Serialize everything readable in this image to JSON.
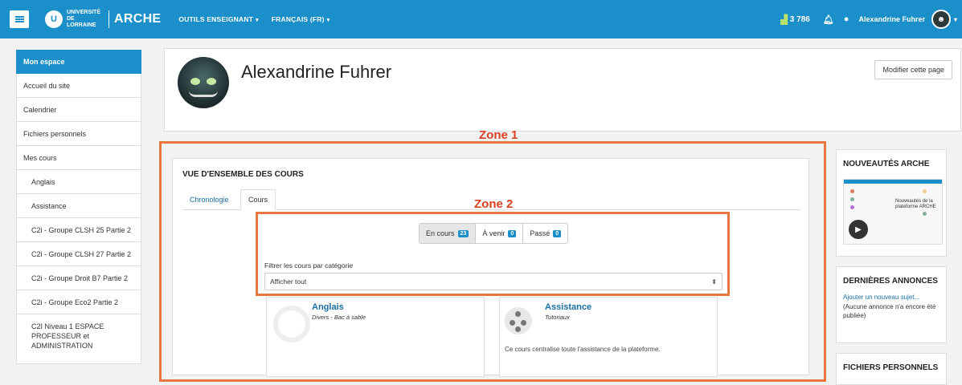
{
  "topbar": {
    "logo_mark": "U",
    "logo_university": "UNIVERSITÉ DE LORRAINE",
    "logo_app": "ARCHE",
    "nav": [
      {
        "label": "OUTILS ENSEIGNANT"
      },
      {
        "label": "FRANÇAIS (FR)"
      }
    ],
    "count": "3 786",
    "username": "Alexandrine Fuhrer"
  },
  "sidebar": {
    "items": [
      {
        "label": "Mon espace"
      },
      {
        "label": "Accueil du site"
      },
      {
        "label": "Calendrier"
      },
      {
        "label": "Fichiers personnels"
      },
      {
        "label": "Mes cours"
      },
      {
        "label": "Anglais"
      },
      {
        "label": "Assistance"
      },
      {
        "label": "C2i - Groupe CLSH 25 Partie 2"
      },
      {
        "label": "C2i - Groupe CLSH 27 Partie 2"
      },
      {
        "label": "C2i - Groupe Droit B7 Partie 2"
      },
      {
        "label": "C2i - Groupe Eco2 Partie 2"
      },
      {
        "label": "C2I Niveau 1 ESPACE PROFESSEUR et ADMINISTRATION"
      }
    ]
  },
  "header": {
    "title": "Alexandrine Fuhrer",
    "edit_button": "Modifier cette page"
  },
  "annotations": {
    "zone1": "Zone 1",
    "zone2": "Zone 2"
  },
  "overview": {
    "title": "VUE D'ENSEMBLE DES COURS",
    "tabs": [
      {
        "label": "Chronologie"
      },
      {
        "label": "Cours"
      }
    ],
    "segments": [
      {
        "label": "En cours",
        "badge": "23"
      },
      {
        "label": "À venir",
        "badge": "0"
      },
      {
        "label": "Passé",
        "badge": "0"
      }
    ],
    "filter_label": "Filtrer les cours par catégorie",
    "filter_value": "Afficher tout",
    "courses": [
      {
        "title": "Anglais",
        "subtitle": "Divers - Bac à sable",
        "progress": "0%"
      },
      {
        "title": "Assistance",
        "subtitle": "Tutoriaux",
        "description": "Ce cours centralise toute l'assistance de la plateforme."
      }
    ]
  },
  "blocks": {
    "news": {
      "title": "NOUVEAUTÉS ARCHE",
      "thumb_text": "Nouveautés de la plateforme ARCHE"
    },
    "announcements": {
      "title": "DERNIÈRES ANNONCES",
      "link": "Ajouter un nouveau sujet...",
      "note": "(Aucune annonce n'a encore été publiée)"
    },
    "files": {
      "title": "FICHIERS PERSONNELS"
    }
  },
  "colors": {
    "brand": "#1a8fc9",
    "zone_outline": "#e8773f",
    "zone_label": "#d8401f"
  }
}
